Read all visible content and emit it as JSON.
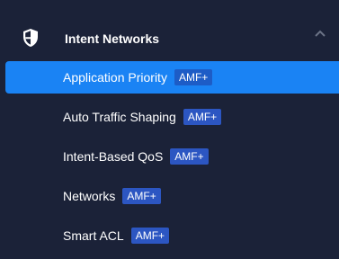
{
  "menu": {
    "group_title": "Intent Networks",
    "group_icon": "shield-icon",
    "collapse_icon": "chevron-up-icon",
    "colors": {
      "background": "#1b2238",
      "active": "#1a83f4",
      "badge": "#2c56c2"
    },
    "items": [
      {
        "label": "Application Priority",
        "badge": "AMF+",
        "active": true
      },
      {
        "label": "Auto Traffic Shaping",
        "badge": "AMF+",
        "active": false
      },
      {
        "label": "Intent-Based QoS",
        "badge": "AMF+",
        "active": false
      },
      {
        "label": "Networks",
        "badge": "AMF+",
        "active": false
      },
      {
        "label": "Smart ACL",
        "badge": "AMF+",
        "active": false
      }
    ]
  }
}
